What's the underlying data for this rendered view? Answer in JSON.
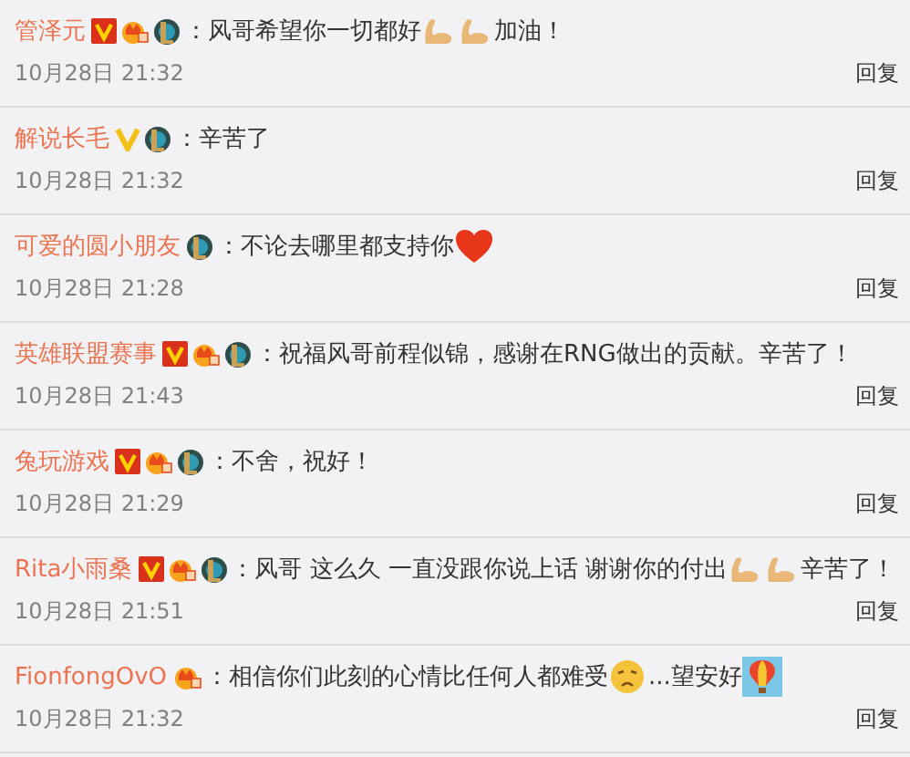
{
  "comments": [
    {
      "user": "管泽元",
      "badges": [
        {
          "kind": "verified_red"
        },
        {
          "kind": "crown"
        },
        {
          "kind": "game"
        }
      ],
      "parts": [
        {
          "kind": "text",
          "text": "：风哥希望你一切都好"
        },
        {
          "kind": "muscle"
        },
        {
          "kind": "muscle"
        },
        {
          "kind": "text",
          "text": "加油！"
        }
      ],
      "time": "10月28日 21:32",
      "reply": "回复"
    },
    {
      "user": "解说长毛",
      "badges": [
        {
          "kind": "verified_gold"
        },
        {
          "kind": "game"
        }
      ],
      "parts": [
        {
          "kind": "text",
          "text": "：辛苦了"
        }
      ],
      "time": "10月28日 21:32",
      "reply": "回复"
    },
    {
      "user": "可爱的圆小朋友",
      "badges": [
        {
          "kind": "game"
        }
      ],
      "parts": [
        {
          "kind": "text",
          "text": "：不论去哪里都支持你"
        },
        {
          "kind": "heart"
        }
      ],
      "time": "10月28日 21:28",
      "reply": "回复"
    },
    {
      "user": "英雄联盟赛事",
      "badges": [
        {
          "kind": "verified_red"
        },
        {
          "kind": "crown"
        },
        {
          "kind": "game"
        }
      ],
      "parts": [
        {
          "kind": "text",
          "text": "：祝福风哥前程似锦，感谢在RNG做出的贡献。辛苦了！"
        }
      ],
      "time": "10月28日 21:43",
      "reply": "回复"
    },
    {
      "user": "兔玩游戏",
      "badges": [
        {
          "kind": "verified_red"
        },
        {
          "kind": "crown"
        },
        {
          "kind": "game"
        }
      ],
      "parts": [
        {
          "kind": "text",
          "text": "：不舍，祝好！"
        }
      ],
      "time": "10月28日 21:29",
      "reply": "回复"
    },
    {
      "user": "Rita小雨桑",
      "badges": [
        {
          "kind": "verified_red"
        },
        {
          "kind": "crown"
        },
        {
          "kind": "game"
        }
      ],
      "parts": [
        {
          "kind": "text",
          "text": "：风哥 这么久 一直没跟你说上话 谢谢你的付出"
        },
        {
          "kind": "muscle"
        },
        {
          "kind": "muscle"
        },
        {
          "kind": "text",
          "text": "辛苦了！"
        }
      ],
      "time": "10月28日 21:51",
      "reply": "回复"
    },
    {
      "user": "FionfongOvO",
      "badges": [
        {
          "kind": "crown"
        }
      ],
      "parts": [
        {
          "kind": "text",
          "text": "：相信你们此刻的心情比任何人都难受"
        },
        {
          "kind": "sad"
        },
        {
          "kind": "text",
          "text": "...望安好"
        },
        {
          "kind": "balloon"
        }
      ],
      "time": "10月28日 21:32",
      "reply": "回复"
    }
  ]
}
